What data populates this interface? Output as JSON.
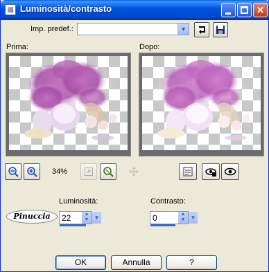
{
  "window": {
    "title": "Luminosità/contrasto"
  },
  "presets": {
    "label": "Imp. predef.:",
    "value": ""
  },
  "preview": {
    "before_label": "Prima:",
    "after_label": "Dopo:",
    "zoom_percent": "34%"
  },
  "params": {
    "brightness_label": "Luminosità:",
    "brightness_value": "22",
    "contrast_label": "Contrasto:",
    "contrast_value": "0"
  },
  "buttons": {
    "ok": "OK",
    "cancel": "Annulla",
    "help": "?"
  },
  "watermark": "Pinuccia",
  "colors": {
    "titlebar": "#0054E3",
    "dialog_bg": "#ECE9D8",
    "accent": "#3566C8"
  }
}
